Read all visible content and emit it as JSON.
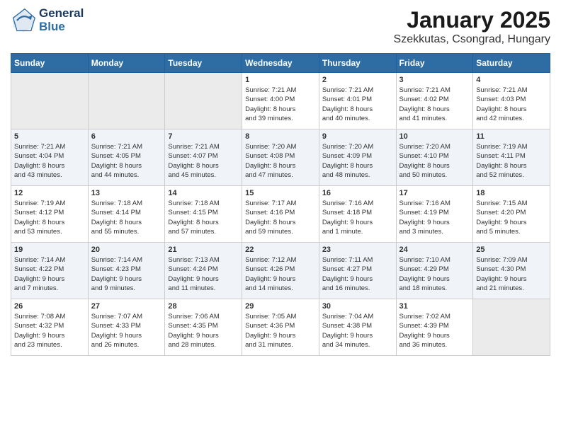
{
  "header": {
    "logo_line1": "General",
    "logo_line2": "Blue",
    "title": "January 2025",
    "subtitle": "Szekkutas, Csongrad, Hungary"
  },
  "weekdays": [
    "Sunday",
    "Monday",
    "Tuesday",
    "Wednesday",
    "Thursday",
    "Friday",
    "Saturday"
  ],
  "weeks": [
    [
      {
        "day": "",
        "info": ""
      },
      {
        "day": "",
        "info": ""
      },
      {
        "day": "",
        "info": ""
      },
      {
        "day": "1",
        "info": "Sunrise: 7:21 AM\nSunset: 4:00 PM\nDaylight: 8 hours\nand 39 minutes."
      },
      {
        "day": "2",
        "info": "Sunrise: 7:21 AM\nSunset: 4:01 PM\nDaylight: 8 hours\nand 40 minutes."
      },
      {
        "day": "3",
        "info": "Sunrise: 7:21 AM\nSunset: 4:02 PM\nDaylight: 8 hours\nand 41 minutes."
      },
      {
        "day": "4",
        "info": "Sunrise: 7:21 AM\nSunset: 4:03 PM\nDaylight: 8 hours\nand 42 minutes."
      }
    ],
    [
      {
        "day": "5",
        "info": "Sunrise: 7:21 AM\nSunset: 4:04 PM\nDaylight: 8 hours\nand 43 minutes."
      },
      {
        "day": "6",
        "info": "Sunrise: 7:21 AM\nSunset: 4:05 PM\nDaylight: 8 hours\nand 44 minutes."
      },
      {
        "day": "7",
        "info": "Sunrise: 7:21 AM\nSunset: 4:07 PM\nDaylight: 8 hours\nand 45 minutes."
      },
      {
        "day": "8",
        "info": "Sunrise: 7:20 AM\nSunset: 4:08 PM\nDaylight: 8 hours\nand 47 minutes."
      },
      {
        "day": "9",
        "info": "Sunrise: 7:20 AM\nSunset: 4:09 PM\nDaylight: 8 hours\nand 48 minutes."
      },
      {
        "day": "10",
        "info": "Sunrise: 7:20 AM\nSunset: 4:10 PM\nDaylight: 8 hours\nand 50 minutes."
      },
      {
        "day": "11",
        "info": "Sunrise: 7:19 AM\nSunset: 4:11 PM\nDaylight: 8 hours\nand 52 minutes."
      }
    ],
    [
      {
        "day": "12",
        "info": "Sunrise: 7:19 AM\nSunset: 4:12 PM\nDaylight: 8 hours\nand 53 minutes."
      },
      {
        "day": "13",
        "info": "Sunrise: 7:18 AM\nSunset: 4:14 PM\nDaylight: 8 hours\nand 55 minutes."
      },
      {
        "day": "14",
        "info": "Sunrise: 7:18 AM\nSunset: 4:15 PM\nDaylight: 8 hours\nand 57 minutes."
      },
      {
        "day": "15",
        "info": "Sunrise: 7:17 AM\nSunset: 4:16 PM\nDaylight: 8 hours\nand 59 minutes."
      },
      {
        "day": "16",
        "info": "Sunrise: 7:16 AM\nSunset: 4:18 PM\nDaylight: 9 hours\nand 1 minute."
      },
      {
        "day": "17",
        "info": "Sunrise: 7:16 AM\nSunset: 4:19 PM\nDaylight: 9 hours\nand 3 minutes."
      },
      {
        "day": "18",
        "info": "Sunrise: 7:15 AM\nSunset: 4:20 PM\nDaylight: 9 hours\nand 5 minutes."
      }
    ],
    [
      {
        "day": "19",
        "info": "Sunrise: 7:14 AM\nSunset: 4:22 PM\nDaylight: 9 hours\nand 7 minutes."
      },
      {
        "day": "20",
        "info": "Sunrise: 7:14 AM\nSunset: 4:23 PM\nDaylight: 9 hours\nand 9 minutes."
      },
      {
        "day": "21",
        "info": "Sunrise: 7:13 AM\nSunset: 4:24 PM\nDaylight: 9 hours\nand 11 minutes."
      },
      {
        "day": "22",
        "info": "Sunrise: 7:12 AM\nSunset: 4:26 PM\nDaylight: 9 hours\nand 14 minutes."
      },
      {
        "day": "23",
        "info": "Sunrise: 7:11 AM\nSunset: 4:27 PM\nDaylight: 9 hours\nand 16 minutes."
      },
      {
        "day": "24",
        "info": "Sunrise: 7:10 AM\nSunset: 4:29 PM\nDaylight: 9 hours\nand 18 minutes."
      },
      {
        "day": "25",
        "info": "Sunrise: 7:09 AM\nSunset: 4:30 PM\nDaylight: 9 hours\nand 21 minutes."
      }
    ],
    [
      {
        "day": "26",
        "info": "Sunrise: 7:08 AM\nSunset: 4:32 PM\nDaylight: 9 hours\nand 23 minutes."
      },
      {
        "day": "27",
        "info": "Sunrise: 7:07 AM\nSunset: 4:33 PM\nDaylight: 9 hours\nand 26 minutes."
      },
      {
        "day": "28",
        "info": "Sunrise: 7:06 AM\nSunset: 4:35 PM\nDaylight: 9 hours\nand 28 minutes."
      },
      {
        "day": "29",
        "info": "Sunrise: 7:05 AM\nSunset: 4:36 PM\nDaylight: 9 hours\nand 31 minutes."
      },
      {
        "day": "30",
        "info": "Sunrise: 7:04 AM\nSunset: 4:38 PM\nDaylight: 9 hours\nand 34 minutes."
      },
      {
        "day": "31",
        "info": "Sunrise: 7:02 AM\nSunset: 4:39 PM\nDaylight: 9 hours\nand 36 minutes."
      },
      {
        "day": "",
        "info": ""
      }
    ]
  ]
}
